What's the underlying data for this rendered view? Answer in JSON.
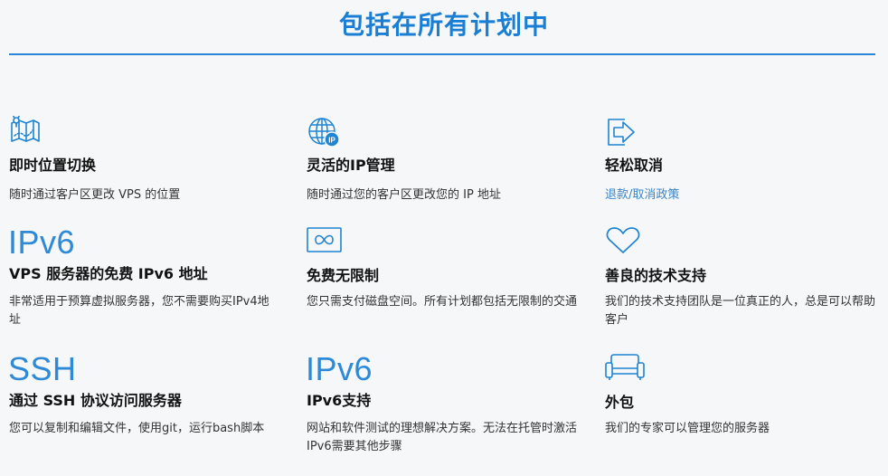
{
  "title": "包括在所有计划中",
  "features": [
    {
      "icon": "map-pin-icon",
      "title": "即时位置切换",
      "desc": "随时通过客户区更改 VPS 的位置"
    },
    {
      "icon": "globe-ip-icon",
      "title": "灵活的IP管理",
      "desc": "随时通过您的客户区更改您的 IP 地址"
    },
    {
      "icon": "exit-arrow-icon",
      "title": "轻松取消",
      "link": "退款/取消政策"
    },
    {
      "big_text": "IPv6",
      "title": "VPS 服务器的免费 IPv6 地址",
      "desc": "非常适用于预算虚拟服务器，您不需要购买IPv4地址"
    },
    {
      "icon": "infinity-icon",
      "title": "免费无限制",
      "desc": "您只需支付磁盘空间。所有计划都包括无限制的交通"
    },
    {
      "icon": "heart-icon",
      "title": "善良的技术支持",
      "desc": "我们的技术支持团队是一位真正的人，总是可以帮助客户"
    },
    {
      "big_text": "SSH",
      "title": "通过 SSH 协议访问服务器",
      "desc": "您可以复制和编辑文件，使用git，运行bash脚本"
    },
    {
      "big_text": "IPv6",
      "title": "IPv6支持",
      "desc": "网站和软件测试的理想解决方案。无法在托管时激活IPv6需要其他步骤"
    },
    {
      "icon": "sofa-icon",
      "title": "外包",
      "desc": "我们的专家可以管理您的服务器"
    }
  ],
  "colors": {
    "accent": "#1a7fd4",
    "icon": "#1f84d1",
    "link": "#3a86c8",
    "background": "#f5f7f8"
  }
}
